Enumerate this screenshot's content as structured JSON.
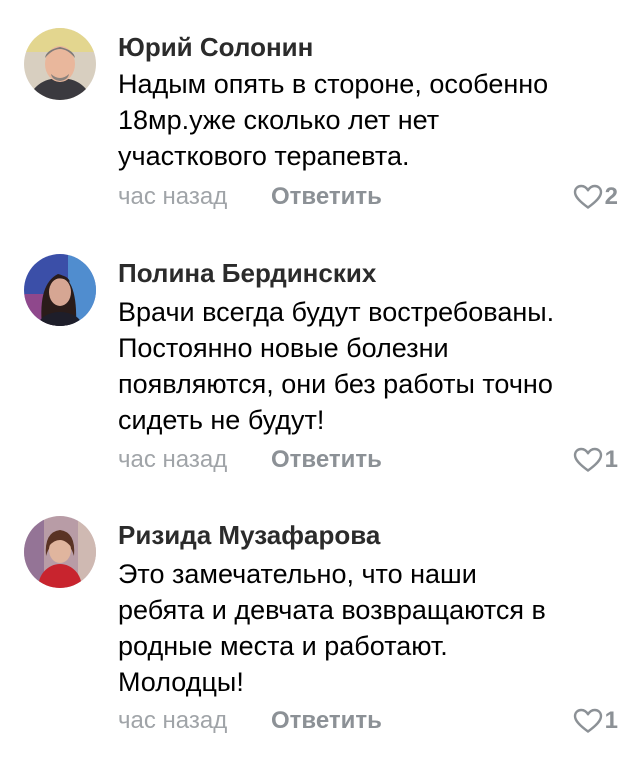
{
  "comments": [
    {
      "author": "Юрий Солонин",
      "text_lines": [
        "Надым опять в стороне, особенно",
        "18мр.уже сколько лет нет",
        "участкового терапевта."
      ],
      "time": "час назад",
      "reply_label": "Ответить",
      "likes": "2",
      "like_icon": "heart-outline-icon",
      "avatar_colors": {
        "bg": "#d8cfc0",
        "face": "#e9b79c",
        "hair": "#7f7a78",
        "shirt": "#3b3a3f"
      }
    },
    {
      "author": "Полина Бердинских",
      "text_lines": [
        "Врачи всегда будут востребованы.",
        "Постоянно новые болезни",
        "появляются, они без работы точно",
        "сидеть не будут!"
      ],
      "time": "час назад",
      "reply_label": "Ответить",
      "likes": "1",
      "like_icon": "heart-outline-icon",
      "avatar_colors": {
        "bg": "#3b4fa8",
        "face": "#d6a693",
        "hair": "#2a1c1a",
        "shirt": "#1e1e2a"
      }
    },
    {
      "author": "Ризида Музафарова",
      "text_lines": [
        "Это замечательно, что наши",
        "ребята и девчата возвращаются в",
        "родные места и работают.",
        "Молодцы!"
      ],
      "time": "час назад",
      "reply_label": "Ответить",
      "likes": "1",
      "like_icon": "heart-outline-icon",
      "avatar_colors": {
        "bg": "#b89ca6",
        "face": "#e0b59e",
        "hair": "#5a3324",
        "shirt": "#c8242e"
      }
    }
  ]
}
